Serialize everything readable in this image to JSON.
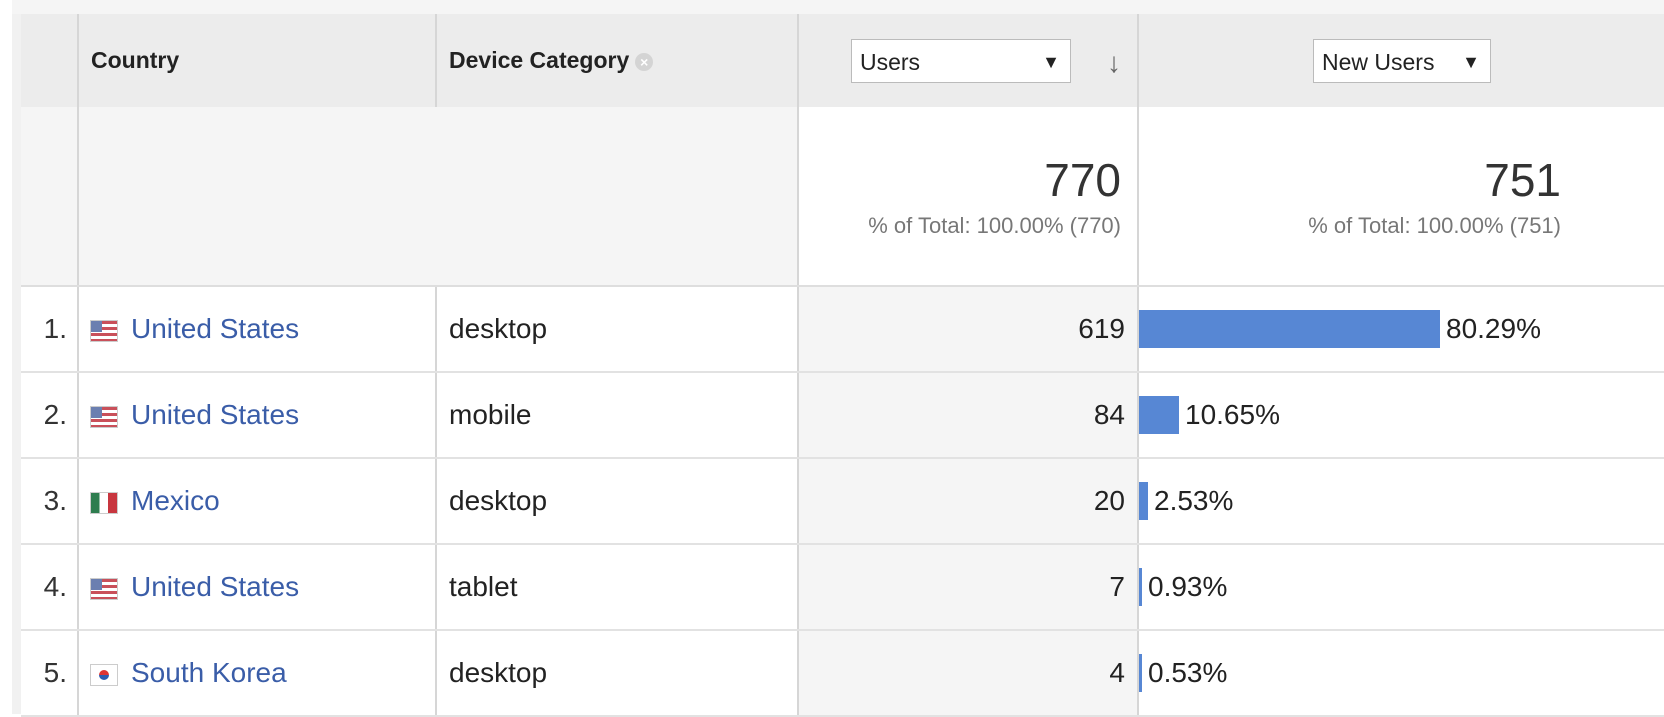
{
  "table": {
    "headers": {
      "country": "Country",
      "device_category": "Device Category",
      "users_metric": "Users",
      "new_users_metric": "New Users"
    },
    "totals": {
      "users": {
        "value": "770",
        "pct": "% of Total: 100.00% (770)"
      },
      "new_users": {
        "value": "751",
        "pct": "% of Total: 100.00% (751)"
      }
    },
    "rows": [
      {
        "rank": "1.",
        "country": "United States",
        "flag": "flag-us-icon",
        "device": "desktop",
        "users": "619",
        "new_users_pct": "80.29%",
        "share": 0.8029
      },
      {
        "rank": "2.",
        "country": "United States",
        "flag": "flag-us-icon",
        "device": "mobile",
        "users": "84",
        "new_users_pct": "10.65%",
        "share": 0.1065
      },
      {
        "rank": "3.",
        "country": "Mexico",
        "flag": "flag-mx-icon",
        "device": "desktop",
        "users": "20",
        "new_users_pct": "2.53%",
        "share": 0.0253
      },
      {
        "rank": "4.",
        "country": "United States",
        "flag": "flag-us-icon",
        "device": "tablet",
        "users": "7",
        "new_users_pct": "0.93%",
        "share": 0.0093
      },
      {
        "rank": "5.",
        "country": "South Korea",
        "flag": "flag-kr-icon",
        "device": "desktop",
        "users": "4",
        "new_users_pct": "0.53%",
        "share": 0.0053
      }
    ]
  },
  "colors": {
    "bar": "#5787d4",
    "link": "#3a5da8"
  }
}
